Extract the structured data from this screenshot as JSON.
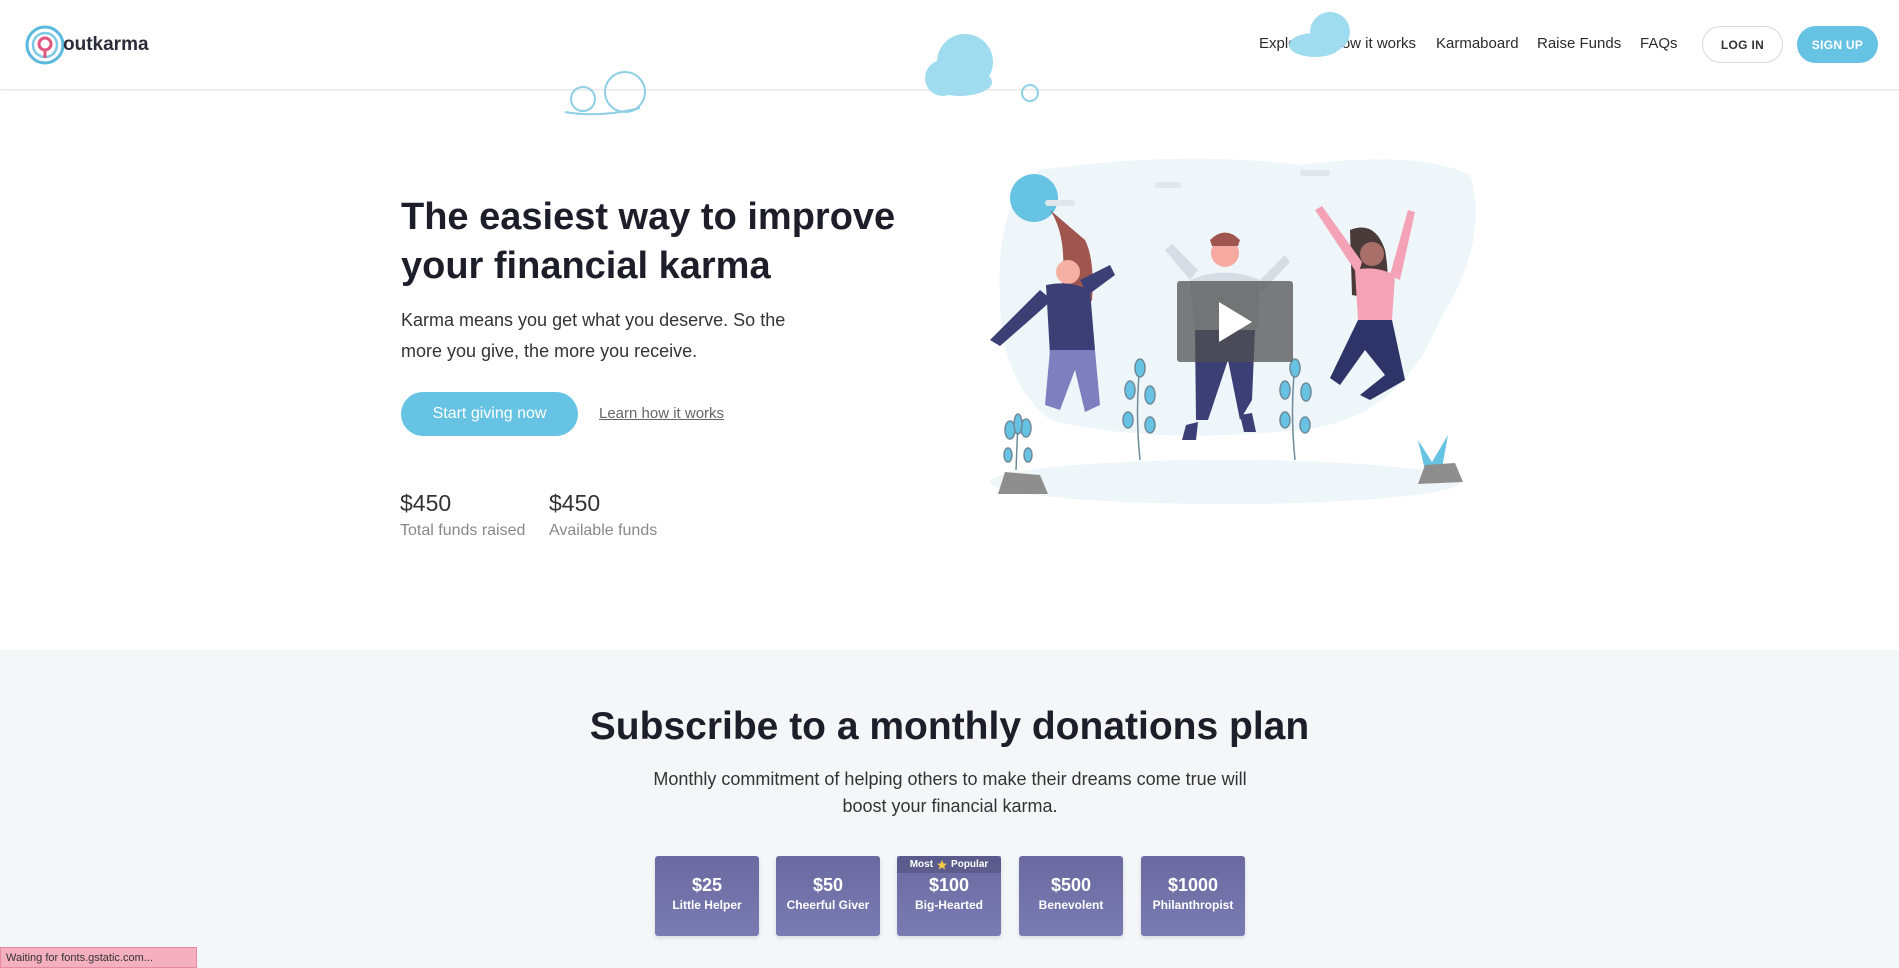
{
  "header": {
    "logo_text": "outkarma",
    "nav": [
      "Explore",
      "How it works",
      "Karmaboard",
      "Raise Funds",
      "FAQs"
    ],
    "login_label": "LOG IN",
    "signup_label": "SIGN UP"
  },
  "hero": {
    "title_line1": "The easiest way to improve",
    "title_line2": "your financial karma",
    "subtitle_line1": "Karma means you get what you deserve. So the",
    "subtitle_line2": "more you give, the more you receive.",
    "start_button": "Start giving now",
    "learn_link": "Learn how it works",
    "stats": [
      {
        "value": "$450",
        "label": "Total funds raised"
      },
      {
        "value": "$450",
        "label": "Available funds"
      }
    ]
  },
  "subscribe": {
    "title": "Subscribe to a monthly donations plan",
    "desc_line1": "Monthly commitment of helping others to make their dreams come true will",
    "desc_line2": "boost your financial karma.",
    "plans": [
      {
        "amount": "$25",
        "name": "Little Helper"
      },
      {
        "amount": "$50",
        "name": "Cheerful Giver"
      },
      {
        "amount": "$100",
        "name": "Big-Hearted",
        "badge_left": "Most",
        "badge_right": "Popular"
      },
      {
        "amount": "$500",
        "name": "Benevolent"
      },
      {
        "amount": "$1000",
        "name": "Philanthropist"
      }
    ]
  },
  "status_bar": "Waiting for fonts.gstatic.com...",
  "colors": {
    "accent": "#67c3e3",
    "plan": "#6e6fa6",
    "section_bg": "#f4f7f8"
  }
}
